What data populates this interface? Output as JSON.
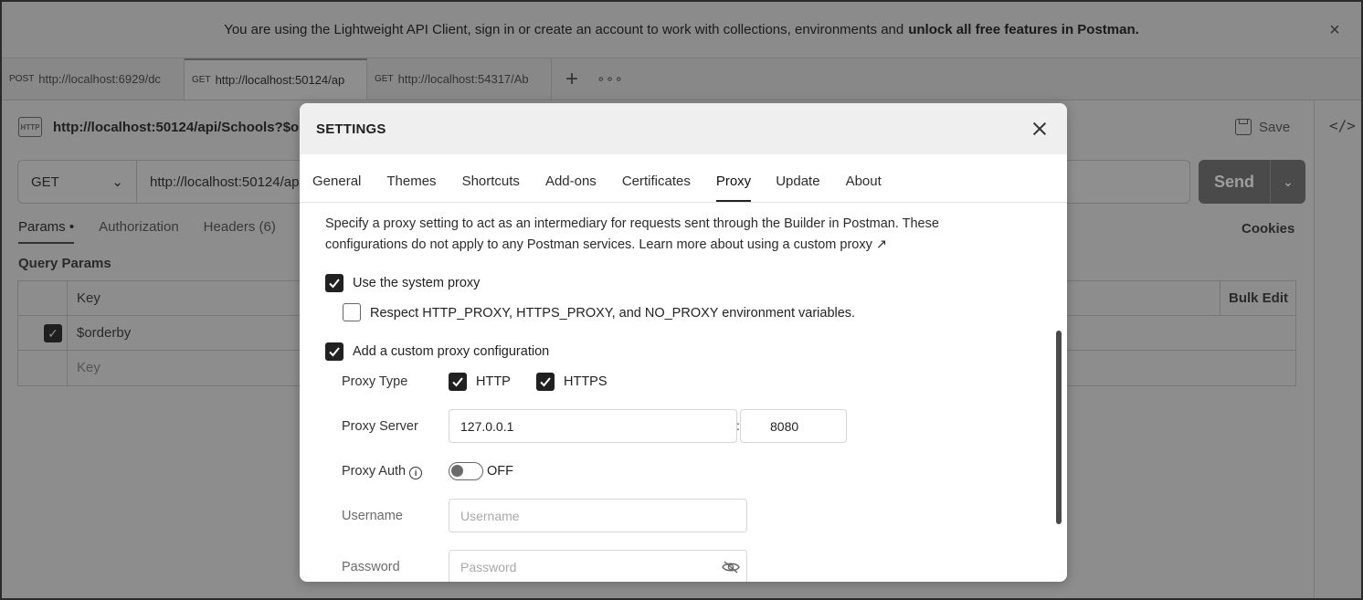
{
  "banner": {
    "text": "You are using the Lightweight API Client, sign in or create an account to work with collections, environments and",
    "bold_text": "unlock all free features in Postman.",
    "close_icon": "close-icon"
  },
  "request_tabs": [
    {
      "method": "POST",
      "url": "http://localhost:6929/dc"
    },
    {
      "method": "GET",
      "url": "http://localhost:50124/ap"
    },
    {
      "method": "GET",
      "url": "http://localhost:54317/Ab"
    }
  ],
  "request": {
    "title": "http://localhost:50124/api/Schools?$or",
    "save_label": "Save",
    "method": "GET",
    "url": "http://localhost:50124/ap",
    "send_label": "Send"
  },
  "params": {
    "tabs": [
      "Params",
      "Authorization",
      "Headers (6)"
    ],
    "cookies_label": "Cookies",
    "query_params_label": "Query Params",
    "key_header": "Key",
    "bulk_edit_label": "Bulk Edit",
    "rows": [
      {
        "key": "$orderby",
        "checked": true
      }
    ],
    "key_placeholder": "Key"
  },
  "settings": {
    "title": "SETTINGS",
    "tabs": [
      "General",
      "Themes",
      "Shortcuts",
      "Add-ons",
      "Certificates",
      "Proxy",
      "Update",
      "About"
    ],
    "active_tab": "Proxy",
    "description": "Specify a proxy setting to act as an intermediary for requests sent through the Builder in Postman. These configurations do not apply to any Postman services. Learn more about using a custom proxy ↗",
    "use_system_proxy": {
      "label": "Use the system proxy",
      "checked": true
    },
    "respect_env": {
      "label": "Respect HTTP_PROXY, HTTPS_PROXY, and NO_PROXY environment variables.",
      "checked": false
    },
    "custom_proxy": {
      "label": "Add a custom proxy configuration",
      "checked": true
    },
    "proxy_type": {
      "label": "Proxy Type",
      "http_label": "HTTP",
      "http_checked": true,
      "https_label": "HTTPS",
      "https_checked": true
    },
    "proxy_server": {
      "label": "Proxy Server",
      "host": "127.0.0.1",
      "separator": ":",
      "port": "8080"
    },
    "proxy_auth": {
      "label": "Proxy Auth",
      "state": "OFF"
    },
    "username": {
      "label": "Username",
      "placeholder": "Username"
    },
    "password": {
      "label": "Password",
      "placeholder": "Password"
    }
  }
}
